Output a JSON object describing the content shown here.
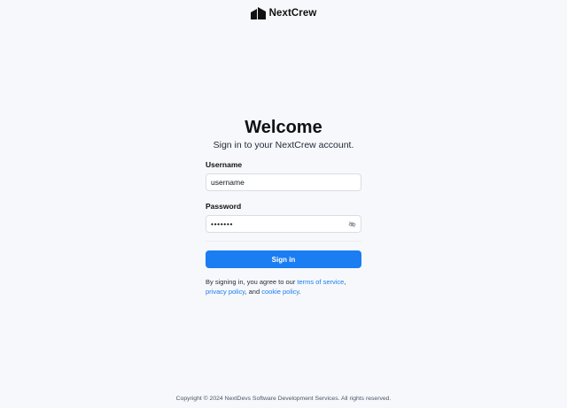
{
  "header": {
    "brand_name": "NextCrew",
    "logo_icon": "nextcrew-logo-icon"
  },
  "login": {
    "title": "Welcome",
    "subtitle": "Sign in to your NextCrew account.",
    "username_label": "Username",
    "username_value": "username",
    "password_label": "Password",
    "password_value": "•••••••",
    "show_password_icon": "eye-slash-icon",
    "signin_label": "Sign in",
    "legal": {
      "prefix": "By signing in, you agree to our ",
      "terms_link": "terms of service",
      "sep1": ",",
      "privacy_link": "privacy policy",
      "sep2": ", and ",
      "cookie_link": "cookie policy",
      "suffix": "."
    }
  },
  "footer": {
    "copyright": "Copyright © 2024 NextDevs Software Development Services. All rights reserved."
  },
  "colors": {
    "accent": "#1a7df2",
    "background": "#f7f8fb"
  }
}
